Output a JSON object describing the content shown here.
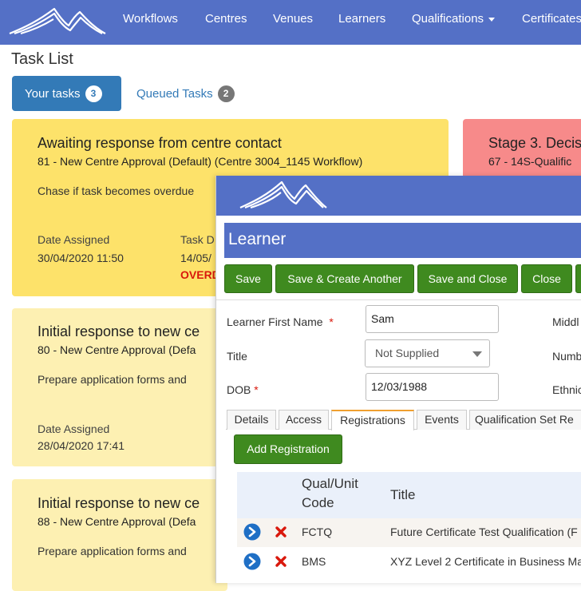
{
  "nav": {
    "items": [
      "Workflows",
      "Centres",
      "Venues",
      "Learners",
      "Qualifications",
      "Certificates"
    ]
  },
  "page": {
    "title": "Task List"
  },
  "tabs": {
    "yours": {
      "label": "Your tasks",
      "count": "3"
    },
    "queued": {
      "label": "Queued Tasks",
      "count": "2"
    }
  },
  "cards": [
    {
      "title": "Awaiting response from centre contact",
      "subtitle": "81 - New Centre Approval (Default) (Centre 3004_1145 Workflow)",
      "description": "Chase if task becomes overdue",
      "date_label": "Date Assigned",
      "date_value": "30/04/2020 11:50",
      "due_label": "Task D",
      "due_value": "14/05/",
      "status": "OVERD",
      "color": "#fde26a"
    },
    {
      "title": "Stage 3. Decis",
      "subtitle": "67 - 14S-Qualific",
      "color": "#f78a8a"
    },
    {
      "title": "Initial response to new ce",
      "subtitle": "80 - New Centre Approval (Defa",
      "description": "Prepare application forms and",
      "date_label": "Date Assigned",
      "date_value": "28/04/2020 17:41",
      "color": "#fdf0b2"
    },
    {
      "title": "Initial response to new ce",
      "subtitle": "88 - New Centre Approval (Defa",
      "description": "Prepare application forms and",
      "color": "#fdf0b2"
    }
  ],
  "learner": {
    "heading": "Learner",
    "buttons": [
      "Save",
      "Save & Create Another",
      "Save and Close",
      "Close"
    ],
    "fields": {
      "first_name_label": "Learner First Name",
      "first_name_value": "Sam",
      "title_label": "Title",
      "title_value": "Not Supplied",
      "dob_label": "DOB",
      "dob_value": "12/03/1988",
      "middle_label": "Middl",
      "number_label": "Numb",
      "ethnic_label": "Ethnic",
      "required_marker": "*"
    },
    "tabs": [
      "Details",
      "Access",
      "Registrations",
      "Events",
      "Qualification Set Re"
    ],
    "active_tab": "Registrations",
    "add_button": "Add Registration",
    "table": {
      "headers": [
        "Qual/Unit Code",
        "Title"
      ],
      "rows": [
        {
          "code": "FCTQ",
          "title": "Future Certificate Test Qualification (F"
        },
        {
          "code": "BMS",
          "title": "XYZ Level 2 Certificate in Business Ma"
        }
      ]
    }
  },
  "colors": {
    "brand": "#5470c6",
    "primary": "#337ab7",
    "success": "#3f8a1f",
    "danger": "#d9180c"
  }
}
